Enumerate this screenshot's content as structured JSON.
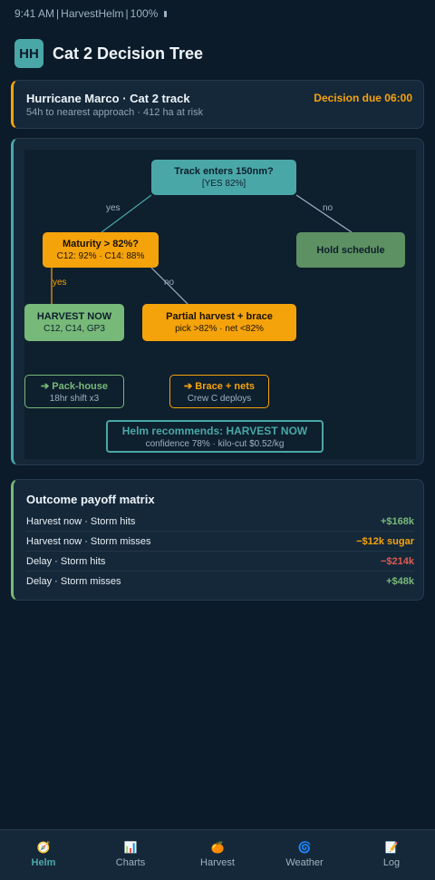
{
  "status_bar": {
    "time": "9:41 AM",
    "app": "HarvestHelm",
    "battery": "100%",
    "separator": "|"
  },
  "header": {
    "logo_text": "HH",
    "title": "Cat 2 Decision Tree"
  },
  "alert": {
    "title": "Hurricane Marco · Cat 2 track",
    "subtitle": "54h to nearest approach · 412 ha at risk",
    "deadline": "Decision due 06:00"
  },
  "tree": {
    "root": {
      "title": "Track enters 150nm?",
      "sub": "[YES 82%]"
    },
    "edge_root_yes": "yes",
    "edge_root_no": "no",
    "maturity": {
      "title": "Maturity > 82%?",
      "sub": "C12: 92% · C14: 88%"
    },
    "hold": {
      "title": "Hold schedule"
    },
    "edge_maturity_yes": "yes",
    "edge_maturity_no": "no",
    "harvest_now": {
      "title": "HARVEST NOW",
      "sub": "C12, C14, GP3"
    },
    "partial": {
      "title": "Partial harvest + brace",
      "sub": "pick >82% · net <82%"
    },
    "packhouse": {
      "title": "➔ Pack-house",
      "sub": "18hr shift x3"
    },
    "brace": {
      "title": "➔ Brace + nets",
      "sub": "Crew C deploys"
    },
    "recommendation": {
      "title": "Helm recommends: HARVEST NOW",
      "sub": "confidence 78% · kilo-cut $0.52/kg"
    },
    "colors": {
      "teal": "#4aa7a8",
      "orange": "#f5a30b",
      "green": "#77b978",
      "hold_green": "#5d9062"
    }
  },
  "matrix": {
    "title": "Outcome payoff matrix",
    "rows": [
      {
        "label": "Harvest now · Storm hits",
        "value": "+$168k",
        "color": "#77b978"
      },
      {
        "label": "Harvest now · Storm misses",
        "value": "−$12k sugar",
        "color": "#f5a30b"
      },
      {
        "label": "Delay · Storm hits",
        "value": "−$214k",
        "color": "#e05a4f"
      },
      {
        "label": "Delay · Storm misses",
        "value": "+$48k",
        "color": "#77b978"
      }
    ]
  },
  "tabs": [
    {
      "label": "Helm",
      "icon": "compass-icon",
      "glyph": "🧭",
      "active": true
    },
    {
      "label": "Charts",
      "icon": "bar-chart-icon",
      "glyph": "📊",
      "active": false
    },
    {
      "label": "Harvest",
      "icon": "fruit-icon",
      "glyph": "🍊",
      "active": false
    },
    {
      "label": "Weather",
      "icon": "cyclone-icon",
      "glyph": "🌀",
      "active": false
    },
    {
      "label": "Log",
      "icon": "memo-icon",
      "glyph": "📝",
      "active": false
    }
  ]
}
